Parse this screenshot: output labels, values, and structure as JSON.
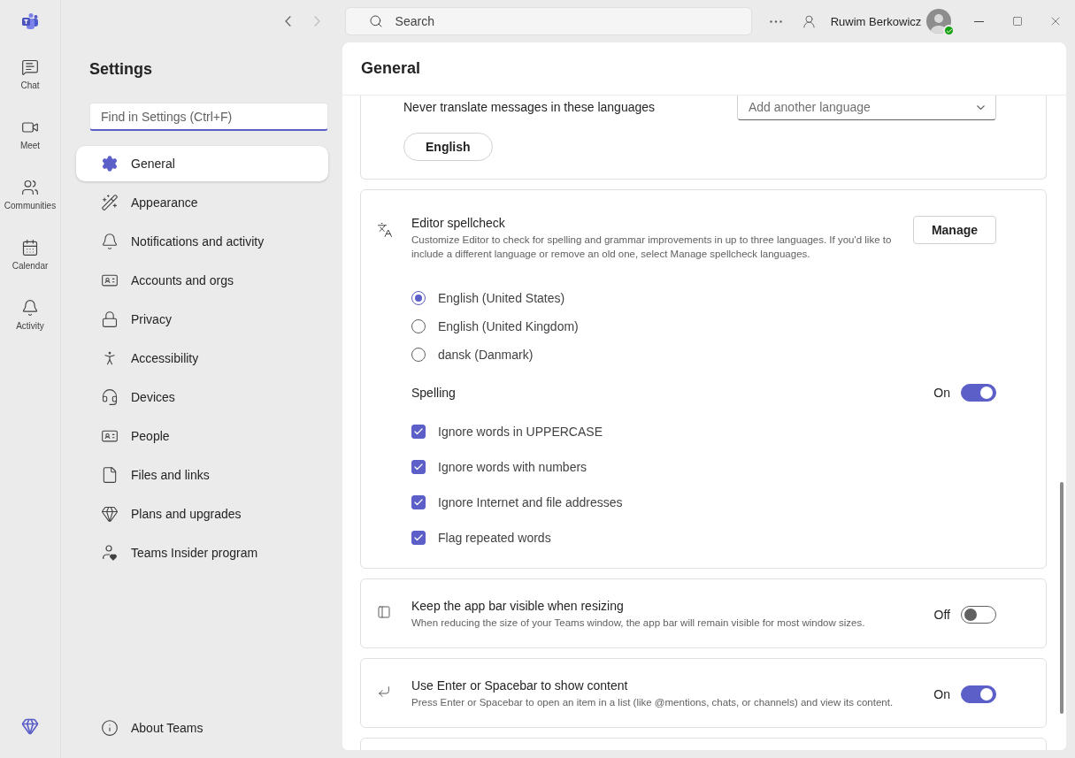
{
  "app_rail": {
    "items": [
      {
        "label": "Chat",
        "selected": false
      },
      {
        "label": "Meet",
        "selected": false
      },
      {
        "label": "Communities",
        "selected": false
      },
      {
        "label": "Calendar",
        "selected": false
      },
      {
        "label": "Activity",
        "selected": false
      }
    ]
  },
  "top_bar": {
    "search_placeholder": "Search",
    "user_name": "Ruwim Berkowicz"
  },
  "settings": {
    "title": "Settings",
    "search_placeholder": "Find in Settings (Ctrl+F)",
    "items": [
      {
        "label": "General",
        "selected": true
      },
      {
        "label": "Appearance",
        "selected": false
      },
      {
        "label": "Notifications and activity",
        "selected": false
      },
      {
        "label": "Accounts and orgs",
        "selected": false
      },
      {
        "label": "Privacy",
        "selected": false
      },
      {
        "label": "Accessibility",
        "selected": false
      },
      {
        "label": "Devices",
        "selected": false
      },
      {
        "label": "People",
        "selected": false
      },
      {
        "label": "Files and links",
        "selected": false
      },
      {
        "label": "Plans and upgrades",
        "selected": false
      },
      {
        "label": "Teams Insider program",
        "selected": false
      }
    ],
    "footer_item": {
      "label": "About Teams"
    }
  },
  "page": {
    "title": "General",
    "translate": {
      "label": "Never translate messages in these languages",
      "dropdown_placeholder": "Add another language",
      "chips": [
        "English"
      ]
    },
    "spellcheck": {
      "title": "Editor spellcheck",
      "description": "Customize Editor to check for spelling and grammar improvements in up to three languages. If you'd like to include a different language or remove an old one, select Manage spellcheck languages.",
      "button": "Manage",
      "languages": [
        {
          "label": "English (United States)",
          "selected": true
        },
        {
          "label": "English (United Kingdom)",
          "selected": false
        },
        {
          "label": "dansk (Danmark)",
          "selected": false
        }
      ],
      "spelling": {
        "label": "Spelling",
        "state_label": "On",
        "on": true
      },
      "options": [
        {
          "label": "Ignore words in UPPERCASE",
          "checked": true
        },
        {
          "label": "Ignore words with numbers",
          "checked": true
        },
        {
          "label": "Ignore Internet and file addresses",
          "checked": true
        },
        {
          "label": "Flag repeated words",
          "checked": true
        }
      ]
    },
    "toggle_cards": [
      {
        "title": "Keep the app bar visible when resizing",
        "description": "When reducing the size of your Teams window, the app bar will remain visible for most window sizes.",
        "state_label": "Off",
        "on": false
      },
      {
        "title": "Use Enter or Spacebar to show content",
        "description": "Press Enter or Spacebar to open an item in a list (like @mentions, chats, or channels) and view its content.",
        "state_label": "On",
        "on": true
      }
    ]
  }
}
